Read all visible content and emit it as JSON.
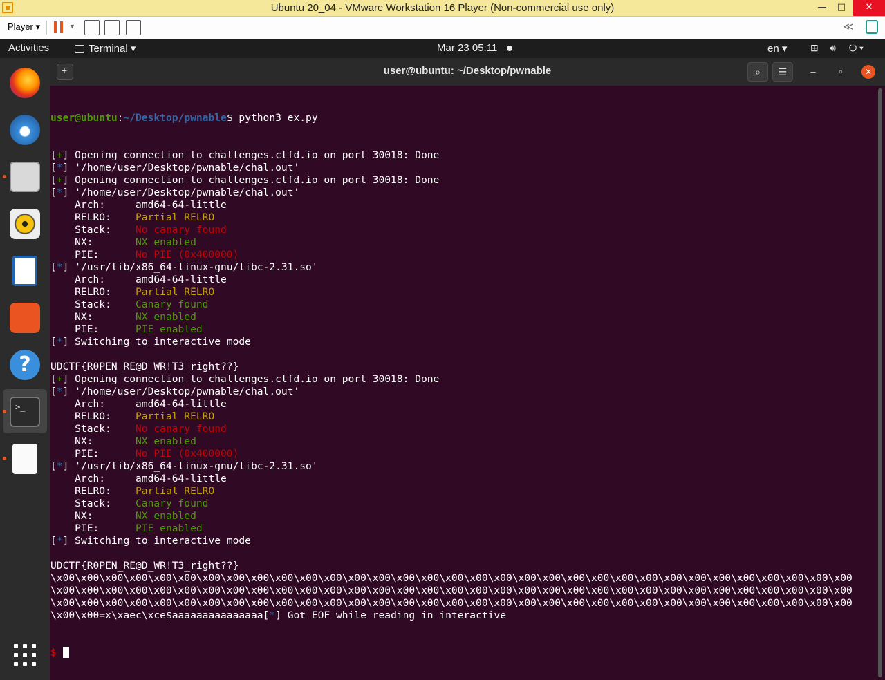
{
  "vmware": {
    "title": "Ubuntu 20_04 - VMware Workstation 16 Player (Non-commercial use only)",
    "player_menu": "Player ▾",
    "minimize": "—",
    "maximize": "□",
    "close": "✕"
  },
  "gnome": {
    "activities": "Activities",
    "app_menu": "Terminal ▾",
    "clock": "Mar 23  05:11",
    "lang": "en ▾"
  },
  "terminal": {
    "title": "user@ubuntu: ~/Desktop/pwnable",
    "prompt_user": "user@ubuntu",
    "prompt_sep": ":",
    "prompt_path": "~/Desktop/pwnable",
    "prompt_end": "$ ",
    "command": "python3 ex.py",
    "lines": [
      {
        "b": "+",
        "t": "Opening connection to challenges.ctfd.io on port 30018: Done"
      },
      {
        "b": "*",
        "t": "'/home/user/Desktop/pwnable/chal.out'"
      },
      {
        "b": "+",
        "t": "Opening connection to challenges.ctfd.io on port 30018: Done"
      },
      {
        "b": "*",
        "t": "'/home/user/Desktop/pwnable/chal.out'"
      },
      {
        "k": "    Arch:     ",
        "v": "amd64-64-little",
        "c": ""
      },
      {
        "k": "    RELRO:    ",
        "v": "Partial RELRO",
        "c": "yel"
      },
      {
        "k": "    Stack:    ",
        "v": "No canary found",
        "c": "red"
      },
      {
        "k": "    NX:       ",
        "v": "NX enabled",
        "c": "g"
      },
      {
        "k": "    PIE:      ",
        "v": "No PIE (0x400000)",
        "c": "red"
      },
      {
        "b": "*",
        "t": "'/usr/lib/x86_64-linux-gnu/libc-2.31.so'"
      },
      {
        "k": "    Arch:     ",
        "v": "amd64-64-little",
        "c": ""
      },
      {
        "k": "    RELRO:    ",
        "v": "Partial RELRO",
        "c": "yel"
      },
      {
        "k": "    Stack:    ",
        "v": "Canary found",
        "c": "g"
      },
      {
        "k": "    NX:       ",
        "v": "NX enabled",
        "c": "g"
      },
      {
        "k": "    PIE:      ",
        "v": "PIE enabled",
        "c": "g"
      },
      {
        "b": "*",
        "t": "Switching to interactive mode"
      },
      {
        "p": ""
      },
      {
        "p": "UDCTF{R0PEN_RE@D_WR!T3_right??}"
      },
      {
        "b": "+",
        "t": "Opening connection to challenges.ctfd.io on port 30018: Done"
      },
      {
        "b": "*",
        "t": "'/home/user/Desktop/pwnable/chal.out'"
      },
      {
        "k": "    Arch:     ",
        "v": "amd64-64-little",
        "c": ""
      },
      {
        "k": "    RELRO:    ",
        "v": "Partial RELRO",
        "c": "yel"
      },
      {
        "k": "    Stack:    ",
        "v": "No canary found",
        "c": "red"
      },
      {
        "k": "    NX:       ",
        "v": "NX enabled",
        "c": "g"
      },
      {
        "k": "    PIE:      ",
        "v": "No PIE (0x400000)",
        "c": "red"
      },
      {
        "b": "*",
        "t": "'/usr/lib/x86_64-linux-gnu/libc-2.31.so'"
      },
      {
        "k": "    Arch:     ",
        "v": "amd64-64-little",
        "c": ""
      },
      {
        "k": "    RELRO:    ",
        "v": "Partial RELRO",
        "c": "yel"
      },
      {
        "k": "    Stack:    ",
        "v": "Canary found",
        "c": "g"
      },
      {
        "k": "    NX:       ",
        "v": "NX enabled",
        "c": "g"
      },
      {
        "k": "    PIE:      ",
        "v": "PIE enabled",
        "c": "g"
      },
      {
        "b": "*",
        "t": "Switching to interactive mode"
      },
      {
        "p": ""
      },
      {
        "p": "UDCTF{R0PEN_RE@D_WR!T3_right??}"
      },
      {
        "p": "\\x00\\x00\\x00\\x00\\x00\\x00\\x00\\x00\\x00\\x00\\x00\\x00\\x00\\x00\\x00\\x00\\x00\\x00\\x00\\x00\\x00\\x00\\x00\\x00\\x00\\x00\\x00\\x00\\x00\\x00\\x00\\x00\\x00"
      },
      {
        "p": "\\x00\\x00\\x00\\x00\\x00\\x00\\x00\\x00\\x00\\x00\\x00\\x00\\x00\\x00\\x00\\x00\\x00\\x00\\x00\\x00\\x00\\x00\\x00\\x00\\x00\\x00\\x00\\x00\\x00\\x00\\x00\\x00\\x00"
      },
      {
        "p": "\\x00\\x00\\x00\\x00\\x00\\x00\\x00\\x00\\x00\\x00\\x00\\x00\\x00\\x00\\x00\\x00\\x00\\x00\\x00\\x00\\x00\\x00\\x00\\x00\\x00\\x00\\x00\\x00\\x00\\x00\\x00\\x00\\x00"
      },
      {
        "eof_pre": "\\x00\\x00=x\\xaec\\xce$aaaaaaaaaaaaaaa",
        "b": "*",
        "t": "Got EOF while reading in interactive"
      }
    ],
    "final_prompt": "$ "
  }
}
